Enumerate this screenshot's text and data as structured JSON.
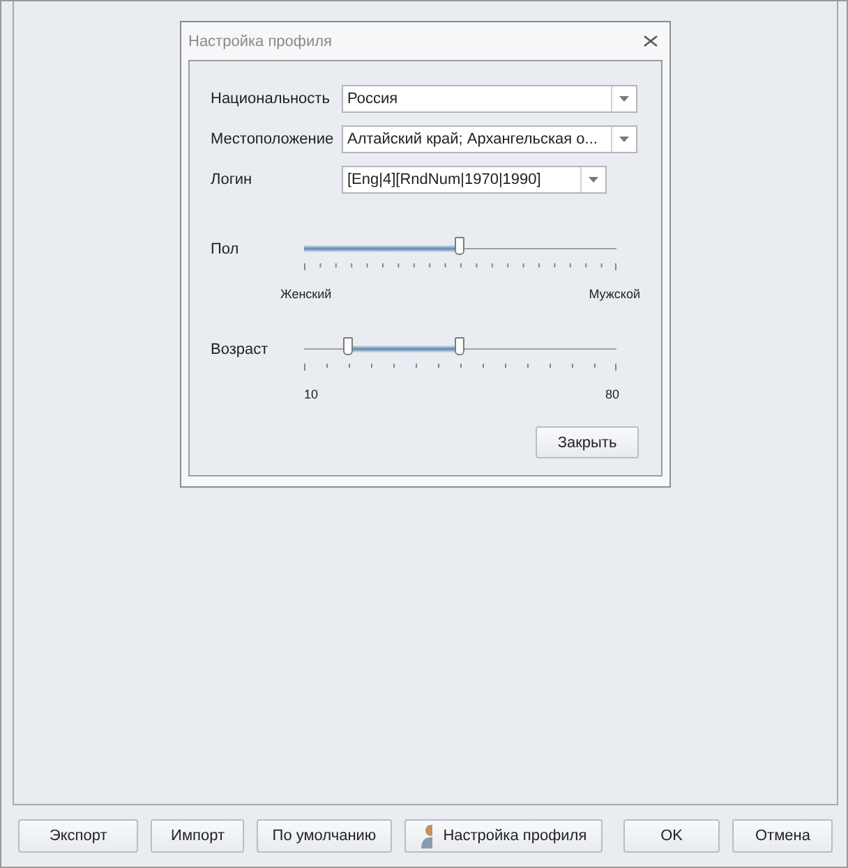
{
  "dialog": {
    "title": "Настройка профиля",
    "fields": [
      {
        "label": "Национальность",
        "value": "Россия",
        "wide": true
      },
      {
        "label": "Местоположение",
        "value": "Алтайский край; Архангельская о...",
        "wide": true
      },
      {
        "label": "Логин",
        "value": "[Eng|4][RndNum|1970|1990]",
        "wide": false
      }
    ],
    "gender": {
      "label": "Пол",
      "level": 0.5,
      "min_label": "Женский",
      "max_label": "Мужской"
    },
    "age": {
      "label": "Возраст",
      "low": {
        "level": 0.143
      },
      "high": {
        "level": 0.5
      },
      "min_label": "10",
      "max_label": "80"
    },
    "close_button": "Закрыть"
  },
  "buttons": [
    {
      "label": "Экспорт",
      "kind": "plain"
    },
    {
      "label": "Импорт",
      "kind": "plain"
    },
    {
      "label": "По умолчанию",
      "kind": "plain"
    },
    {
      "label": "Настройка профиля",
      "kind": "profile"
    },
    {
      "label": "OK",
      "kind": "plain"
    },
    {
      "label": "Отмена",
      "kind": "plain"
    }
  ]
}
